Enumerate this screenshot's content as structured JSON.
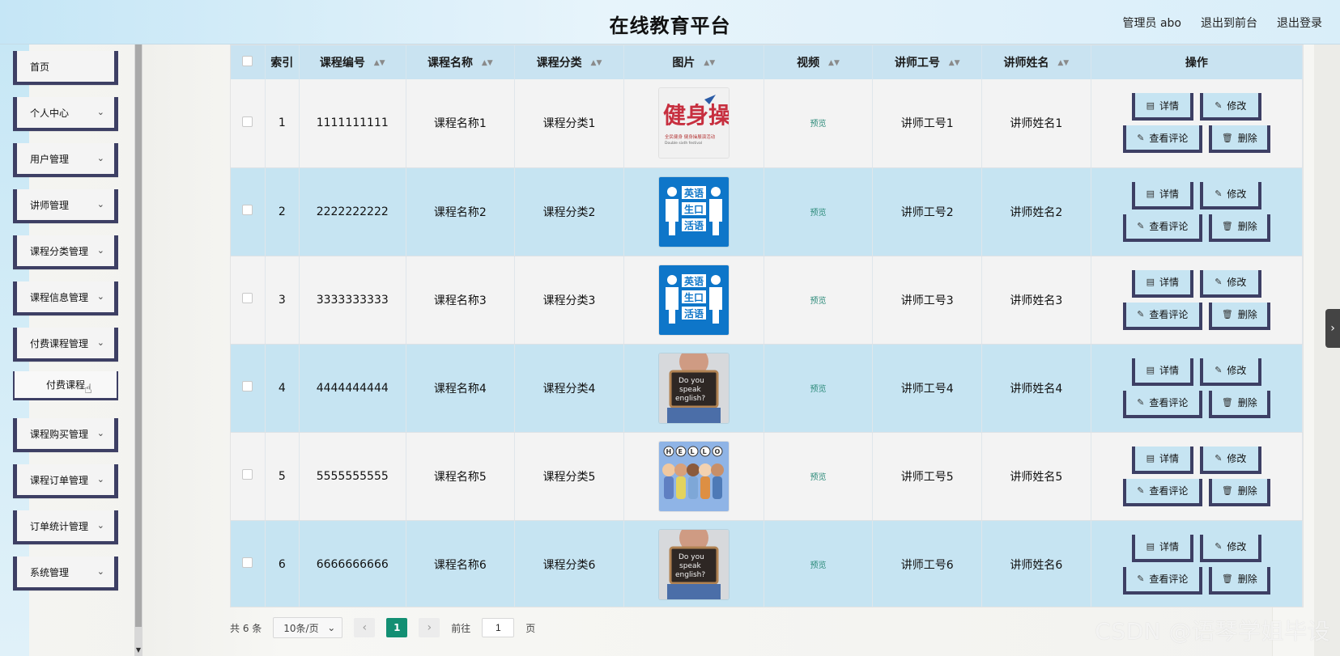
{
  "header": {
    "title": "在线教育平台",
    "admin_label": "管理员 abo",
    "to_front": "退出到前台",
    "logout": "退出登录"
  },
  "sidebar": {
    "items": [
      {
        "label": "首页",
        "has_chevron": false
      },
      {
        "label": "个人中心",
        "has_chevron": true
      },
      {
        "label": "用户管理",
        "has_chevron": true
      },
      {
        "label": "讲师管理",
        "has_chevron": true
      },
      {
        "label": "课程分类管理",
        "has_chevron": true
      },
      {
        "label": "课程信息管理",
        "has_chevron": true
      },
      {
        "label": "付费课程管理",
        "has_chevron": true
      },
      {
        "label": "课程购买管理",
        "has_chevron": true
      },
      {
        "label": "课程订单管理",
        "has_chevron": true
      },
      {
        "label": "订单统计管理",
        "has_chevron": true
      },
      {
        "label": "系统管理",
        "has_chevron": true
      }
    ],
    "submenu": {
      "label": "付费课程"
    }
  },
  "table": {
    "headers": {
      "index": "索引",
      "course_no": "课程编号",
      "course_name": "课程名称",
      "category": "课程分类",
      "image": "图片",
      "video": "视频",
      "teacher_no": "讲师工号",
      "teacher_name": "讲师姓名",
      "actions": "操作"
    },
    "rows": [
      {
        "index": "1",
        "course_no": "1111111111",
        "course_name": "课程名称1",
        "category": "课程分类1",
        "video": "预览",
        "teacher_no": "讲师工号1",
        "teacher_name": "讲师姓名1",
        "image_type": "calligraphy"
      },
      {
        "index": "2",
        "course_no": "2222222222",
        "course_name": "课程名称2",
        "category": "课程分类2",
        "video": "预览",
        "teacher_no": "讲师工号2",
        "teacher_name": "讲师姓名2",
        "image_type": "english_blue"
      },
      {
        "index": "3",
        "course_no": "3333333333",
        "course_name": "课程名称3",
        "category": "课程分类3",
        "video": "预览",
        "teacher_no": "讲师工号3",
        "teacher_name": "讲师姓名3",
        "image_type": "english_blue"
      },
      {
        "index": "4",
        "course_no": "4444444444",
        "course_name": "课程名称4",
        "category": "课程分类4",
        "video": "预览",
        "teacher_no": "讲师工号4",
        "teacher_name": "讲师姓名4",
        "image_type": "speak_sign"
      },
      {
        "index": "5",
        "course_no": "5555555555",
        "course_name": "课程名称5",
        "category": "课程分类5",
        "video": "预览",
        "teacher_no": "讲师工号5",
        "teacher_name": "讲师姓名5",
        "image_type": "hello_people"
      },
      {
        "index": "6",
        "course_no": "6666666666",
        "course_name": "课程名称6",
        "category": "课程分类6",
        "video": "预览",
        "teacher_no": "讲师工号6",
        "teacher_name": "讲师姓名6",
        "image_type": "speak_sign"
      }
    ],
    "actions": {
      "detail": "详情",
      "edit": "修改",
      "comments": "查看评论",
      "delete": "删除"
    }
  },
  "pagination": {
    "total": "共 6 条",
    "page_size": "10条/页",
    "current_page": "1",
    "goto_label": "前往",
    "goto_value": "1",
    "page_suffix": "页"
  },
  "images": {
    "calligraphy": {
      "big_text": "健身操",
      "small_text": "全民健身 健身操展演活动",
      "small_en": "Double sixth festival"
    },
    "english_blue": {
      "line1": "英语",
      "line2": "生口",
      "line3": "活语"
    },
    "speak_sign": {
      "line1": "Do you",
      "line2": "speak",
      "line3": "english?"
    },
    "hello_people": {
      "letters": [
        "H",
        "E",
        "L",
        "L",
        "O"
      ]
    }
  },
  "watermark": "CSDN @语琴学姐毕设",
  "colors": {
    "header_start": "#c5e6f6",
    "header_end": "#d9eef9",
    "table_header": "#c9e3f1",
    "row_alt": "#c6e4f2",
    "row_norm": "#f3f3f3",
    "menu_border": "#3d3f64",
    "preview_link": "#2b8a79",
    "current_page": "#138f73"
  }
}
